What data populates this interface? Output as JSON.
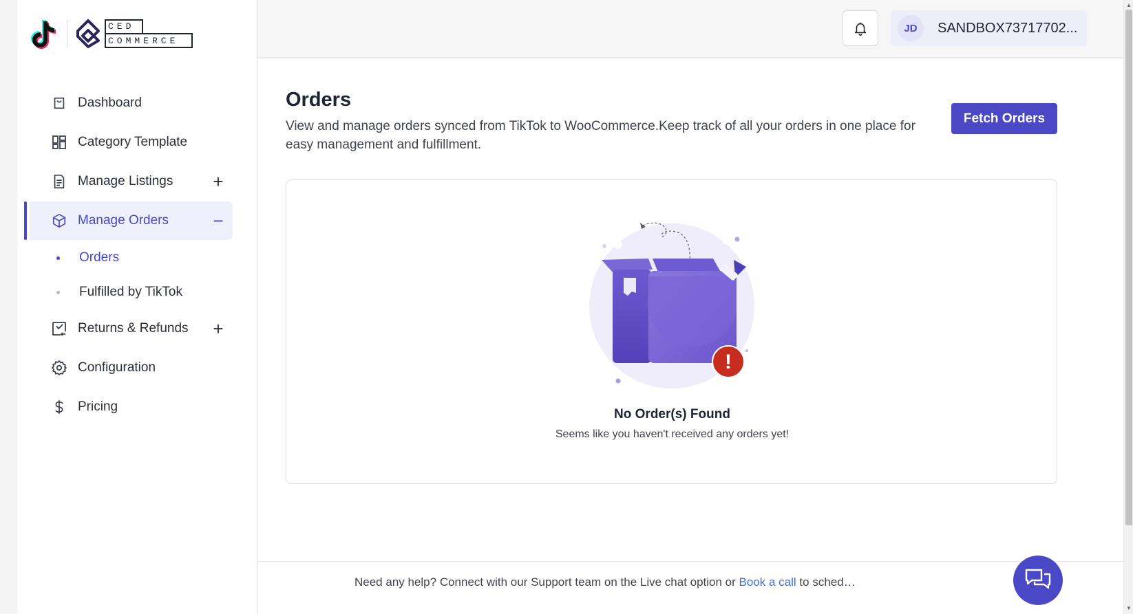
{
  "brand": {
    "logo_top_text": "CED",
    "logo_bottom_text": "COMMERCE"
  },
  "sidebar": {
    "items": [
      {
        "label": "Dashboard",
        "icon": "shopping-bag-icon"
      },
      {
        "label": "Category Template",
        "icon": "layout-grid-icon"
      },
      {
        "label": "Manage Listings",
        "icon": "document-icon",
        "toggle": "+"
      },
      {
        "label": "Manage Orders",
        "icon": "box-icon",
        "toggle": "−",
        "active": true
      },
      {
        "label": "Returns & Refunds",
        "icon": "return-icon",
        "toggle": "+"
      },
      {
        "label": "Configuration",
        "icon": "gear-icon"
      },
      {
        "label": "Pricing",
        "icon": "dollar-icon"
      }
    ],
    "sub_items": [
      {
        "label": "Orders",
        "active": true
      },
      {
        "label": "Fulfilled by TikTok",
        "active": false
      }
    ]
  },
  "header": {
    "user_initials": "JD",
    "user_name": "SANDBOX73717702...",
    "bell_icon": "bell-icon"
  },
  "page": {
    "title": "Orders",
    "description": "View and manage orders synced from TikTok to WooCommerce.Keep track of all your orders in one place for easy management and fulfillment.",
    "fetch_button": "Fetch Orders"
  },
  "empty_state": {
    "title": "No Order(s) Found",
    "subtitle": "Seems like you haven't received any orders yet!",
    "badge": "!"
  },
  "footer": {
    "text_before": "Need any help? Connect with our Support team on the Live chat option or ",
    "link_text": "Book a call",
    "text_after": " to sched…"
  },
  "colors": {
    "accent": "#4b48c6",
    "alert": "#c62d1f",
    "link": "#3d6fd6"
  }
}
